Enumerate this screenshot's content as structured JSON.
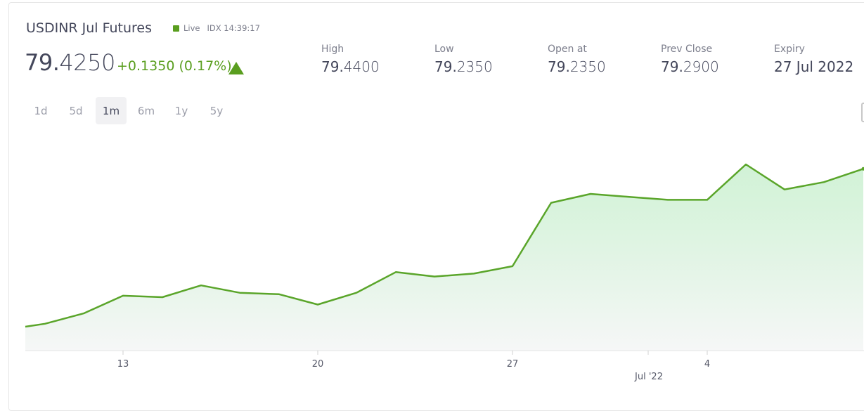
{
  "header": {
    "title": "USDINR Jul Futures",
    "live_label": "Live",
    "exchange_time": "IDX 14:39:17",
    "price_int": "79.",
    "price_dec": "4250",
    "change": "+0.1350 (0.17%)"
  },
  "stats": [
    {
      "label": "High",
      "int": "79.",
      "dec": "4400"
    },
    {
      "label": "Low",
      "int": "79.",
      "dec": "2350"
    },
    {
      "label": "Open at",
      "int": "79.",
      "dec": "2350"
    },
    {
      "label": "Prev Close",
      "int": "79.",
      "dec": "2900"
    },
    {
      "label": "Expiry",
      "int": "27 Jul 2022",
      "dec": ""
    }
  ],
  "ranges": [
    {
      "label": "1d",
      "active": false
    },
    {
      "label": "5d",
      "active": false
    },
    {
      "label": "1m",
      "active": true
    },
    {
      "label": "6m",
      "active": false
    },
    {
      "label": "1y",
      "active": false
    },
    {
      "label": "5y",
      "active": false
    }
  ],
  "colors": {
    "accent": "#5a9e1f",
    "line": "#5aa52a"
  },
  "icons": {
    "trend": "up-triangle-icon"
  },
  "chart_data": {
    "type": "area",
    "x_ticks": [
      "13",
      "20",
      "27",
      "4"
    ],
    "x_secondary_label": "Jul '22",
    "y_axis_visible": false,
    "grid": false,
    "values": [
      78.05,
      78.07,
      78.14,
      78.26,
      78.25,
      78.33,
      78.28,
      78.27,
      78.2,
      78.28,
      78.42,
      78.39,
      78.41,
      78.46,
      78.89,
      78.95,
      78.93,
      78.91,
      78.91,
      79.15,
      78.98,
      79.03,
      79.12
    ],
    "last_value": 79.12
  }
}
